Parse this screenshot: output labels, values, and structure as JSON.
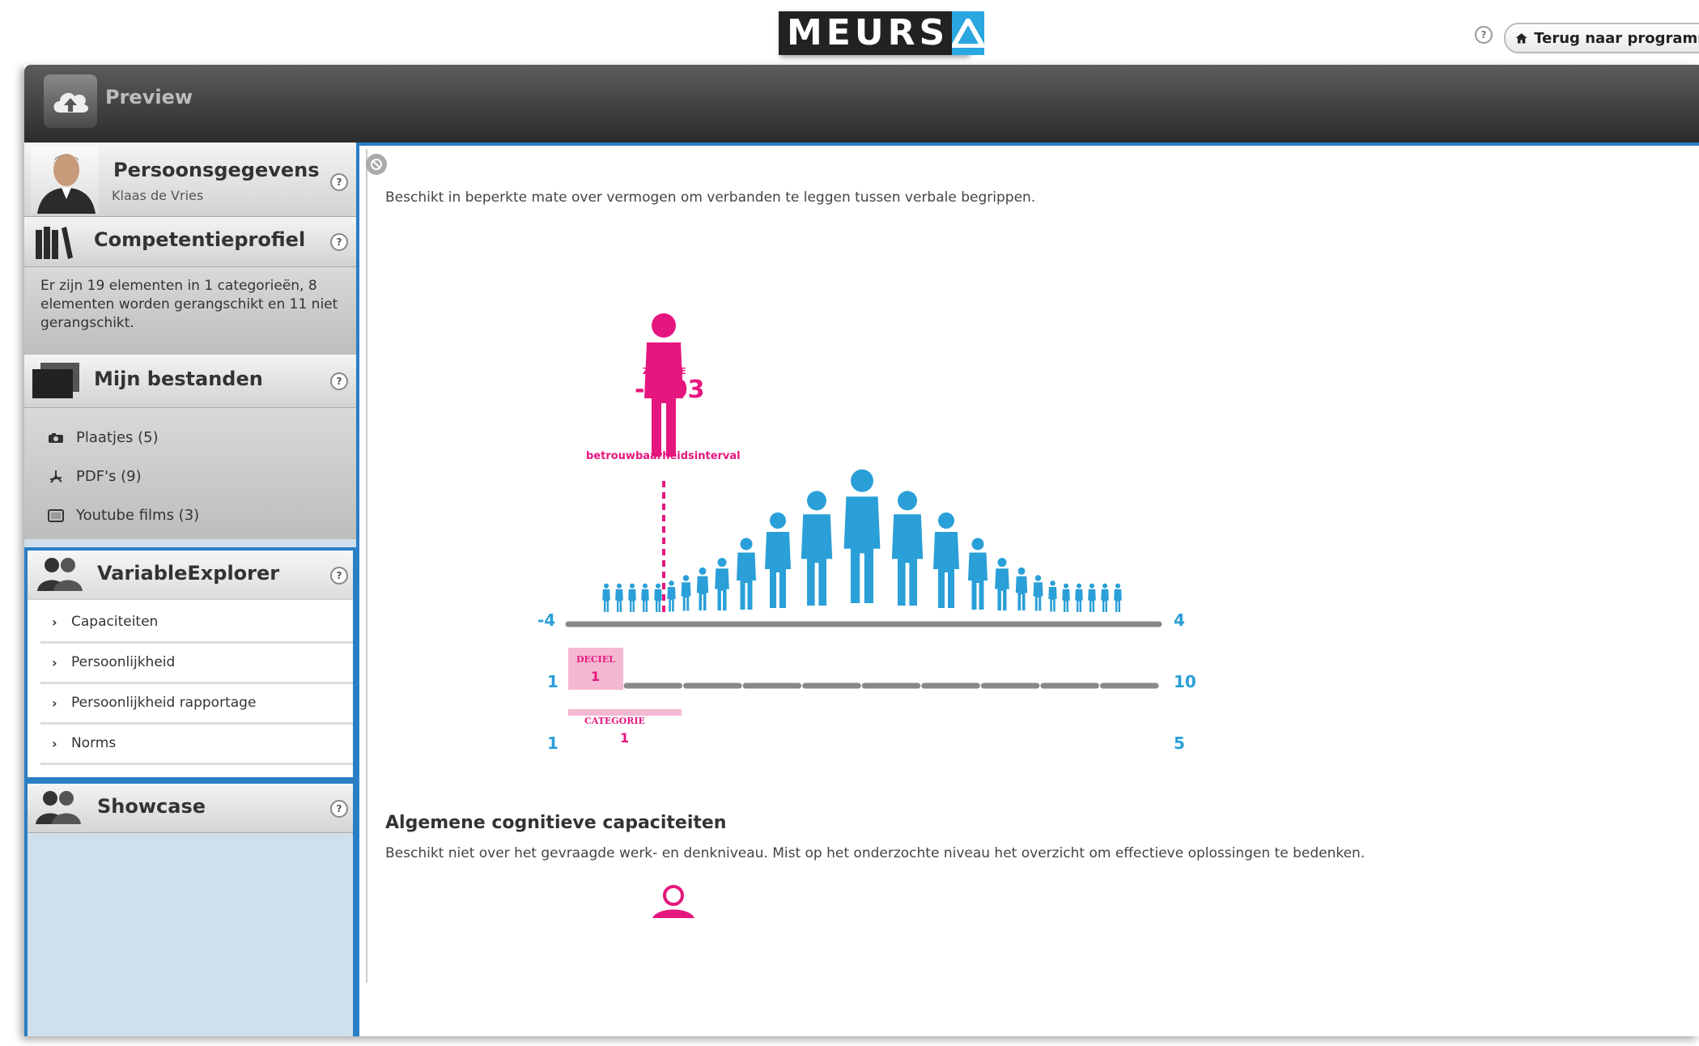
{
  "brand": {
    "logo_text": "MEURS",
    "back_label": "Terug naar programm"
  },
  "topbar": {
    "title": "Preview"
  },
  "sidebar": {
    "persoonsgegevens": {
      "title": "Persoonsgegevens",
      "name": "Klaas de  Vries"
    },
    "competentieprofiel": {
      "title": "Competentieprofiel",
      "summary": "Er zijn 19 elementen in 1 categorieën, 8 elementen worden gerangschikt en 11 niet gerangschikt."
    },
    "bestanden": {
      "title": "Mijn bestanden",
      "items": [
        {
          "label": "Plaatjes (5)",
          "icon": "camera-icon"
        },
        {
          "label": "PDF's (9)",
          "icon": "pdf-icon"
        },
        {
          "label": "Youtube films (3)",
          "icon": "video-icon"
        }
      ]
    },
    "variable_explorer": {
      "title": "VariableExplorer",
      "items": [
        {
          "label": "Capaciteiten"
        },
        {
          "label": "Persoonlijkheid"
        },
        {
          "label": "Persoonlijkheid rapportage"
        },
        {
          "label": "Norms"
        }
      ]
    },
    "showcase": {
      "title": "Showcase"
    },
    "help_glyph": "?"
  },
  "main": {
    "description1": "Beschikt in beperkte mate over vermogen om verbanden te leggen tussen verbale begrippen.",
    "zscore_label": "Z-SCORE",
    "zscore_value": "-2.03",
    "interval_label": "betrouwbaarheidsinterval",
    "scale_z": {
      "min": "-4",
      "max": "4",
      "value": -2.03
    },
    "decile": {
      "label": "DECIEL",
      "value": "1",
      "min": "1",
      "max": "10"
    },
    "category": {
      "label": "CATEGORIE",
      "value": "1",
      "min": "1",
      "max": "5"
    },
    "section2_title": "Algemene cognitieve capaciteiten",
    "description2": "Beschikt niet over het gevraagde werk- en denkniveau. Mist op het onderzochte niveau het overzicht om effectieve oplossingen te bedenken."
  },
  "colors": {
    "accent_blue": "#2a9fd8",
    "highlight_pink": "#e5177e",
    "frame_blue": "#2a7ec6"
  }
}
